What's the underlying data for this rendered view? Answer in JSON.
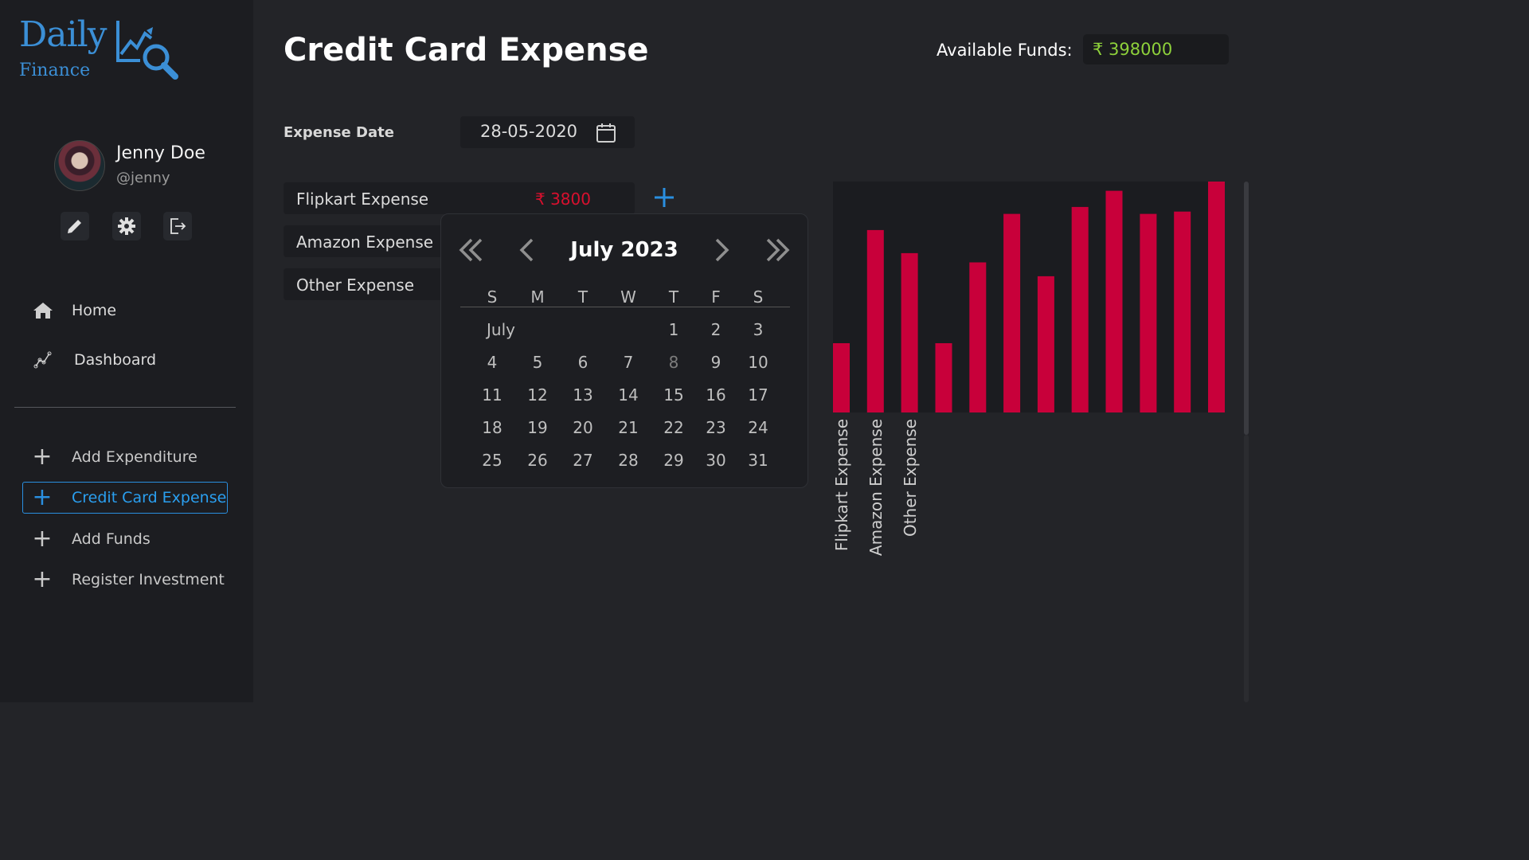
{
  "sidebar": {
    "logo": {
      "top": "Daily",
      "bottom": "Finance"
    },
    "user": {
      "name": "Jenny Doe",
      "handle": "@jenny"
    },
    "tools": [
      "edit-icon",
      "settings-icon",
      "logout-icon"
    ],
    "nav": [
      {
        "label": "Home",
        "icon": "home-icon"
      },
      {
        "label": "Dashboard",
        "icon": "chart-line-icon"
      }
    ],
    "actions": [
      {
        "label": "Add Expenditure"
      },
      {
        "label": "Credit Card Expense",
        "active": true
      },
      {
        "label": "Add Funds"
      },
      {
        "label": "Register Investment"
      }
    ]
  },
  "header": {
    "title": "Credit Card Expense",
    "funds_label": "Available Funds:",
    "funds_value": "₹ 398000"
  },
  "form": {
    "date_label": "Expense Date",
    "date_value": "28-05-2020",
    "rows": [
      {
        "label": "Flipkart Expense",
        "value": "₹ 3800"
      },
      {
        "label": "Amazon Expense",
        "value": ""
      },
      {
        "label": "Other Expense",
        "value": ""
      }
    ]
  },
  "calendar": {
    "month_year": "July 2023",
    "month_label": "July",
    "weekdays": [
      "S",
      "M",
      "T",
      "W",
      "T",
      "F",
      "S"
    ],
    "today": "8",
    "weeks": [
      [
        "",
        "",
        "",
        "",
        "1",
        "2",
        "3"
      ],
      [
        "4",
        "5",
        "6",
        "7",
        "8",
        "9",
        "10"
      ],
      [
        "11",
        "12",
        "13",
        "14",
        "15",
        "16",
        "17"
      ],
      [
        "18",
        "19",
        "20",
        "21",
        "22",
        "23",
        "24"
      ],
      [
        "25",
        "26",
        "27",
        "28",
        "29",
        "30",
        "31"
      ]
    ]
  },
  "colors": {
    "accent": "#2a8fe0",
    "bar": "#c8003a",
    "funds": "#8ed13b",
    "expense": "#d8102e"
  },
  "chart_data": {
    "type": "bar",
    "categories": [
      "Flipkart Expense",
      "Amazon Expense",
      "Other Expense",
      "",
      "",
      "",
      "",
      "",
      "",
      "",
      "",
      ""
    ],
    "values": [
      30,
      79,
      69,
      30,
      65,
      86,
      59,
      89,
      96,
      86,
      87,
      100
    ],
    "ylim": [
      0,
      100
    ],
    "grid": false,
    "legend": "none"
  }
}
